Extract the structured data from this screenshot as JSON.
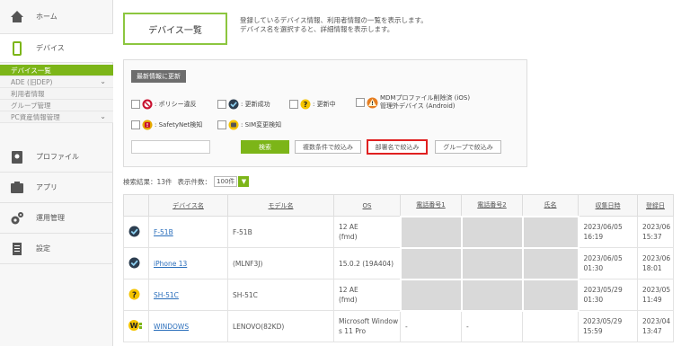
{
  "sidebar": {
    "items": [
      {
        "label": "ホーム",
        "icon": "home-icon"
      },
      {
        "label": "デバイス",
        "icon": "device-icon"
      },
      {
        "label": "プロファイル",
        "icon": "profile-icon"
      },
      {
        "label": "アプリ",
        "icon": "app-icon"
      },
      {
        "label": "運用管理",
        "icon": "gear-icon"
      },
      {
        "label": "設定",
        "icon": "settings-icon"
      }
    ],
    "subitems": [
      {
        "label": "デバイス一覧"
      },
      {
        "label": "ADE (旧DEP)"
      },
      {
        "label": "利用者情報"
      },
      {
        "label": "グループ管理"
      },
      {
        "label": "PC資産情報管理"
      }
    ]
  },
  "header": {
    "title": "デバイス一覧",
    "desc1": "登録しているデバイス情報、利用者情報の一覧を表示します。",
    "desc2": "デバイス名を選択すると、詳細情報を表示します。"
  },
  "panel": {
    "refresh_label": "最新情報に更新",
    "legend": {
      "policy": ": ポリシー違反",
      "success": ": 更新成功",
      "updating": ": 更新中",
      "mdm1": "MDMプロファイル削除済 (iOS)",
      "mdm2": "管理外デバイス (Android)",
      "safetynet": ": SafetyNet検知",
      "sim": ": SIM変更検知"
    },
    "search_value": "",
    "search_label": "検索",
    "filter_multi": "複数条件で絞込み",
    "filter_dept": "部署名で絞込み",
    "filter_group": "グループで絞込み"
  },
  "results": {
    "count_label": "検索結果：13件",
    "per_page_label": "表示件数：",
    "per_page_value": "100件"
  },
  "table": {
    "headers": [
      "デバイス名",
      "モデル名",
      "OS",
      "電話番号1",
      "電話番号2",
      "氏名",
      "収集日時",
      "登録日"
    ],
    "rows": [
      {
        "status": "success",
        "device": "F-51B",
        "model": "F-51B",
        "os1": "12 AE",
        "os2": "(fmd)",
        "tel1": "",
        "tel2": "",
        "name": "",
        "date1": "2023/06/05",
        "date2": "16:19",
        "reg1": "2023/06",
        "reg2": "15:37"
      },
      {
        "status": "success",
        "device": "iPhone 13",
        "model": "(MLNF3J)",
        "os1": "15.0.2 (19A404)",
        "os2": "",
        "tel1": "",
        "tel2": "",
        "name": "",
        "date1": "2023/06/05",
        "date2": "01:30",
        "reg1": "2023/06",
        "reg2": "18:01"
      },
      {
        "status": "updating",
        "device": "SH-51C",
        "model": "SH-51C",
        "os1": "12 AE",
        "os2": "(fmd)",
        "tel1": "",
        "tel2": "",
        "name": "",
        "date1": "2023/05/29",
        "date2": "01:30",
        "reg1": "2023/05",
        "reg2": "11:49"
      },
      {
        "status": "windows",
        "device": "WINDOWS",
        "model": "LENOVO(82KD)",
        "os1": "Microsoft Window",
        "os2": "s 11 Pro",
        "tel1": "-",
        "tel2": "-",
        "name": "",
        "date1": "2023/05/29",
        "date2": "15:59",
        "reg1": "2023/04",
        "reg2": "13:47"
      }
    ]
  },
  "colors": {
    "accent": "#7cb518",
    "link": "#2a6ebb",
    "highlight": "#e02020"
  }
}
